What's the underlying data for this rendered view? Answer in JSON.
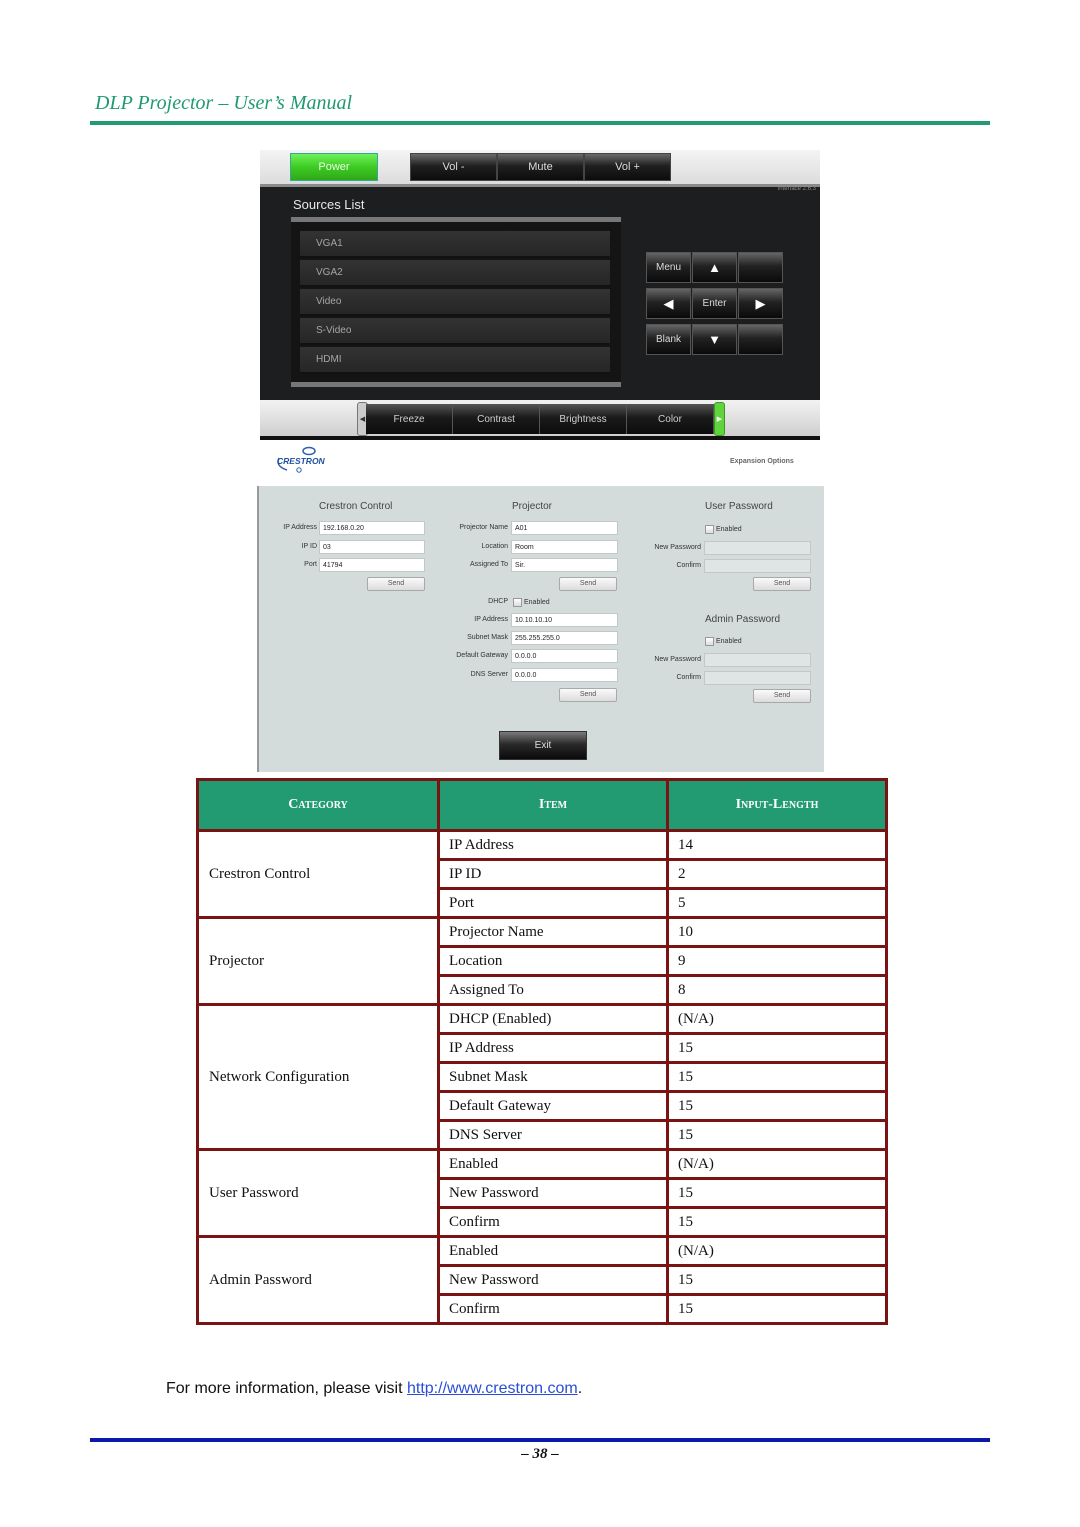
{
  "header": {
    "title": "DLP Projector – User’s Manual"
  },
  "ui": {
    "topbar": {
      "power": "Power",
      "vol_down": "Vol -",
      "mute": "Mute",
      "vol_up": "Vol +"
    },
    "version": "Interface 2.6.3",
    "sources_title": "Sources List",
    "sources": [
      "VGA1",
      "VGA2",
      "Video",
      "S-Video",
      "HDMI"
    ],
    "nav": {
      "menu": "Menu",
      "enter": "Enter",
      "blank": "Blank",
      "up": "▲",
      "down": "▼",
      "left": "◀",
      "right": "▶"
    },
    "bottombar": {
      "left_arrow": "◀",
      "right_arrow": "▶",
      "items": [
        "Freeze",
        "Contrast",
        "Brightness",
        "Color"
      ]
    },
    "logo": "CRESTRON",
    "expansion_options": "Expansion Options"
  },
  "form": {
    "crestron": {
      "title": "Crestron Control",
      "ip_address_label": "IP Address",
      "ip_address": "192.168.0.20",
      "ip_id_label": "IP ID",
      "ip_id": "03",
      "port_label": "Port",
      "port": "41794",
      "send": "Send"
    },
    "projector": {
      "title": "Projector",
      "name_label": "Projector Name",
      "name": "A01",
      "location_label": "Location",
      "location": "Room",
      "assigned_label": "Assigned To",
      "assigned": "Sir.",
      "send": "Send",
      "dhcp_label": "DHCP",
      "dhcp_enabled": "Enabled",
      "ip_label": "IP Address",
      "ip": "10.10.10.10",
      "subnet_label": "Subnet Mask",
      "subnet": "255.255.255.0",
      "gateway_label": "Default Gateway",
      "gateway": "0.0.0.0",
      "dns_label": "DNS Server",
      "dns": "0.0.0.0",
      "send2": "Send"
    },
    "user_password": {
      "title": "User Password",
      "enabled": "Enabled",
      "new_label": "New Password",
      "confirm_label": "Confirm",
      "send": "Send"
    },
    "admin_password": {
      "title": "Admin Password",
      "enabled": "Enabled",
      "new_label": "New Password",
      "confirm_label": "Confirm",
      "send": "Send"
    },
    "exit": "Exit"
  },
  "table": {
    "headers": [
      "Category",
      "Item",
      "Input-Length"
    ],
    "groups": [
      {
        "category": "Crestron Control",
        "rows": [
          [
            "IP Address",
            "14"
          ],
          [
            "IP ID",
            "2"
          ],
          [
            "Port",
            "5"
          ]
        ]
      },
      {
        "category": "Projector",
        "rows": [
          [
            "Projector Name",
            "10"
          ],
          [
            "Location",
            "9"
          ],
          [
            "Assigned To",
            "8"
          ]
        ]
      },
      {
        "category": "Network Configuration",
        "rows": [
          [
            "DHCP (Enabled)",
            "(N/A)"
          ],
          [
            "IP Address",
            "15"
          ],
          [
            "Subnet Mask",
            "15"
          ],
          [
            "Default Gateway",
            "15"
          ],
          [
            "DNS Server",
            "15"
          ]
        ]
      },
      {
        "category": "User Password",
        "rows": [
          [
            "Enabled",
            "(N/A)"
          ],
          [
            "New Password",
            "15"
          ],
          [
            "Confirm",
            "15"
          ]
        ]
      },
      {
        "category": "Admin Password",
        "rows": [
          [
            "Enabled",
            "(N/A)"
          ],
          [
            "New Password",
            "15"
          ],
          [
            "Confirm",
            "15"
          ]
        ]
      }
    ]
  },
  "footer": {
    "more_info_prefix": "For more information, please visit ",
    "link": "http://www.crestron.com",
    "more_info_suffix": ".",
    "page_number": "– 38 –"
  }
}
